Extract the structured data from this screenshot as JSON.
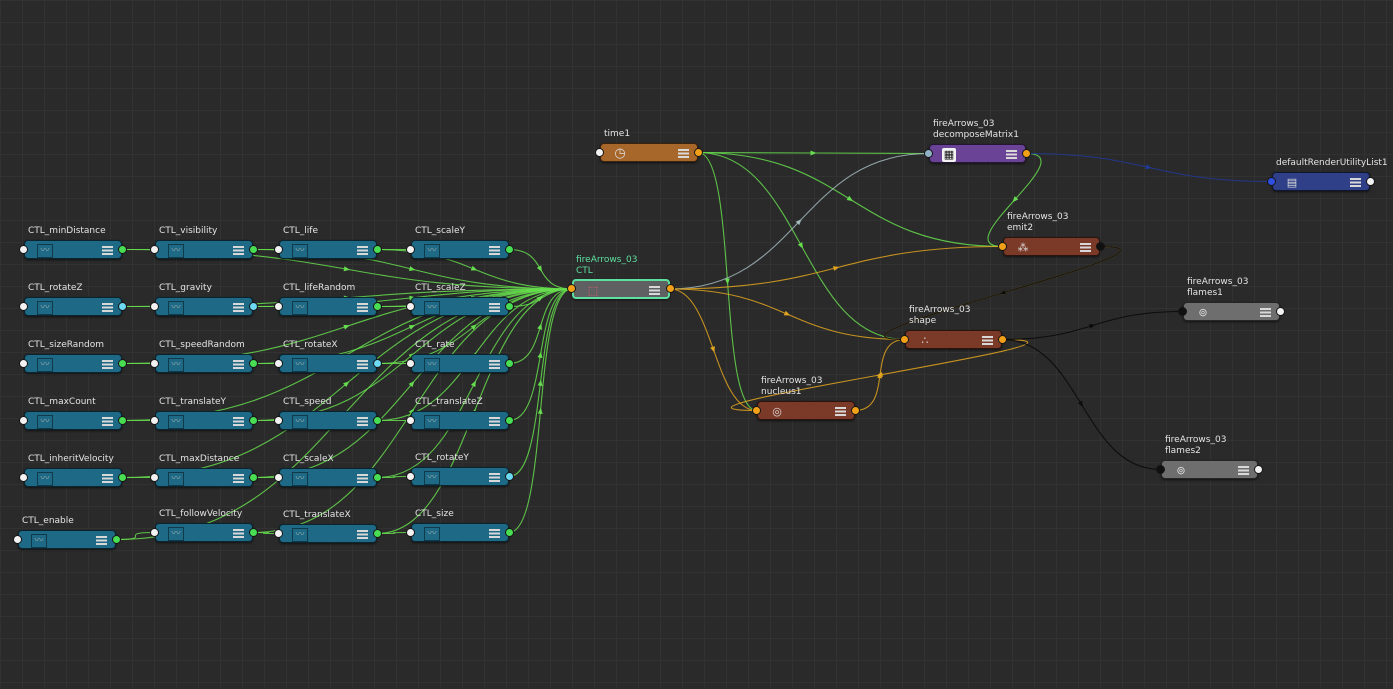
{
  "colors": {
    "ctl_node": "#1e6a86",
    "hub_node": "#5f6061",
    "time_node": "#a8672a",
    "decompose_node": "#6a4396",
    "render_node": "#2f3f88",
    "particle_node": "#7b3a28",
    "shape_node": "#6e6e6e",
    "port_green": "#49dd53",
    "port_white": "#f2f2f2",
    "port_cyan": "#6ed9f2",
    "port_orange": "#f2a018",
    "port_black": "#101010",
    "port_blue": "#2f4fe0",
    "port_slate": "#8fb3c5",
    "wire_green": "#66dd4e",
    "wire_orange": "#e0a420",
    "wire_dark": "#0c0c0c",
    "wire_navy": "#213a9a",
    "wire_grey": "#a2b8bc",
    "selection": "#5de0a0"
  },
  "nodes": [
    {
      "id": "ctl_minDistance",
      "label": "CTL_minDistance",
      "icon": "curve-icon",
      "color": "ctl_node",
      "in_port": "white",
      "out_port": "green"
    },
    {
      "id": "ctl_visibility",
      "label": "CTL_visibility",
      "icon": "curve-icon",
      "color": "ctl_node",
      "in_port": "white",
      "out_port": "green"
    },
    {
      "id": "ctl_life",
      "label": "CTL_life",
      "icon": "curve-icon",
      "color": "ctl_node",
      "in_port": "white",
      "out_port": "green"
    },
    {
      "id": "ctl_scaleY",
      "label": "CTL_scaleY",
      "icon": "curve-icon",
      "color": "ctl_node",
      "in_port": "white",
      "out_port": "green"
    },
    {
      "id": "ctl_rotateZ",
      "label": "CTL_rotateZ",
      "icon": "curve-icon",
      "color": "ctl_node",
      "in_port": "white",
      "out_port": "cyan"
    },
    {
      "id": "ctl_gravity",
      "label": "CTL_gravity",
      "icon": "curve-icon",
      "color": "ctl_node",
      "in_port": "white",
      "out_port": "cyan"
    },
    {
      "id": "ctl_lifeRandom",
      "label": "CTL_lifeRandom",
      "icon": "curve-icon",
      "color": "ctl_node",
      "in_port": "white",
      "out_port": "green"
    },
    {
      "id": "ctl_scaleZ",
      "label": "CTL_scaleZ",
      "icon": "curve-icon",
      "color": "ctl_node",
      "in_port": "white",
      "out_port": "green"
    },
    {
      "id": "ctl_sizeRandom",
      "label": "CTL_sizeRandom",
      "icon": "curve-icon",
      "color": "ctl_node",
      "in_port": "white",
      "out_port": "green"
    },
    {
      "id": "ctl_speedRandom",
      "label": "CTL_speedRandom",
      "icon": "curve-icon",
      "color": "ctl_node",
      "in_port": "white",
      "out_port": "green"
    },
    {
      "id": "ctl_rotateX",
      "label": "CTL_rotateX",
      "icon": "curve-icon",
      "color": "ctl_node",
      "in_port": "white",
      "out_port": "cyan"
    },
    {
      "id": "ctl_rate",
      "label": "CTL_rate",
      "icon": "curve-icon",
      "color": "ctl_node",
      "in_port": "white",
      "out_port": "green"
    },
    {
      "id": "ctl_maxCount",
      "label": "CTL_maxCount",
      "icon": "curve-icon",
      "color": "ctl_node",
      "in_port": "white",
      "out_port": "green"
    },
    {
      "id": "ctl_translateY",
      "label": "CTL_translateY",
      "icon": "curve-icon",
      "color": "ctl_node",
      "in_port": "white",
      "out_port": "green"
    },
    {
      "id": "ctl_speed",
      "label": "CTL_speed",
      "icon": "curve-icon",
      "color": "ctl_node",
      "in_port": "white",
      "out_port": "green"
    },
    {
      "id": "ctl_translateZ",
      "label": "CTL_translateZ",
      "icon": "curve-icon",
      "color": "ctl_node",
      "in_port": "white",
      "out_port": "green"
    },
    {
      "id": "ctl_inheritVelocity",
      "label": "CTL_inheritVelocity",
      "icon": "curve-icon",
      "color": "ctl_node",
      "in_port": "white",
      "out_port": "green"
    },
    {
      "id": "ctl_maxDistance",
      "label": "CTL_maxDistance",
      "icon": "curve-icon",
      "color": "ctl_node",
      "in_port": "white",
      "out_port": "green"
    },
    {
      "id": "ctl_scaleX",
      "label": "CTL_scaleX",
      "icon": "curve-icon",
      "color": "ctl_node",
      "in_port": "white",
      "out_port": "green"
    },
    {
      "id": "ctl_rotateY",
      "label": "CTL_rotateY",
      "icon": "curve-icon",
      "color": "ctl_node",
      "in_port": "white",
      "out_port": "cyan"
    },
    {
      "id": "ctl_enable",
      "label": "CTL_enable",
      "icon": "curve-icon",
      "color": "ctl_node",
      "in_port": "white",
      "out_port": "green"
    },
    {
      "id": "ctl_followVelocity",
      "label": "CTL_followVelocity",
      "icon": "curve-icon",
      "color": "ctl_node",
      "in_port": "white",
      "out_port": "green"
    },
    {
      "id": "ctl_translateX",
      "label": "CTL_translateX",
      "icon": "curve-icon",
      "color": "ctl_node",
      "in_port": "white",
      "out_port": "green"
    },
    {
      "id": "ctl_size",
      "label": "CTL_size",
      "icon": "curve-icon",
      "color": "ctl_node",
      "in_port": "white",
      "out_port": "green"
    },
    {
      "id": "ctl_hub",
      "label": "fireArrows_03\nCTL",
      "icon": "transform-icon",
      "color": "hub_node",
      "in_port": "orange",
      "out_port": "orange",
      "selected": true
    },
    {
      "id": "time1",
      "label": "time1",
      "icon": "clock-icon",
      "color": "time_node",
      "in_port": "white",
      "out_port": "orange"
    },
    {
      "id": "decompose",
      "label": "fireArrows_03\ndecomposeMatrix1",
      "icon": "matrix-icon",
      "color": "decompose_node",
      "in_port": "slate",
      "out_port": "orange"
    },
    {
      "id": "render_list",
      "label": "defaultRenderUtilityList1",
      "icon": "utility-list-icon",
      "color": "render_node",
      "in_port": "blue",
      "out_port": "white"
    },
    {
      "id": "emit2",
      "label": "fireArrows_03\nemit2",
      "icon": "emitter-icon",
      "color": "particle_node",
      "in_port": "orange",
      "out_port": "black"
    },
    {
      "id": "shape",
      "label": "fireArrows_03\nshape",
      "icon": "particles-icon",
      "color": "particle_node",
      "in_port": "orange",
      "out_port": "orange"
    },
    {
      "id": "nucleus1",
      "label": "fireArrows_03\nnucleus1",
      "icon": "nucleus-icon",
      "color": "particle_node",
      "in_port": "orange",
      "out_port": "orange"
    },
    {
      "id": "flames1",
      "label": "fireArrows_03\nflames1",
      "icon": "material-icon",
      "color": "shape_node",
      "in_port": "black",
      "out_port": "white"
    },
    {
      "id": "flames2",
      "label": "fireArrows_03\nflames2",
      "icon": "material-icon",
      "color": "shape_node",
      "in_port": "black",
      "out_port": "white"
    }
  ],
  "connections": [
    {
      "from": "ctl_minDistance",
      "to": "ctl_visibility",
      "color": "wire_green"
    },
    {
      "from": "ctl_visibility",
      "to": "ctl_life",
      "color": "wire_green"
    },
    {
      "from": "ctl_life",
      "to": "ctl_scaleY",
      "color": "wire_green"
    },
    {
      "from": "ctl_rotateZ",
      "to": "ctl_gravity",
      "color": "wire_green"
    },
    {
      "from": "ctl_gravity",
      "to": "ctl_lifeRandom",
      "color": "wire_green"
    },
    {
      "from": "ctl_lifeRandom",
      "to": "ctl_scaleZ",
      "color": "wire_green"
    },
    {
      "from": "ctl_sizeRandom",
      "to": "ctl_speedRandom",
      "color": "wire_green"
    },
    {
      "from": "ctl_speedRandom",
      "to": "ctl_rotateX",
      "color": "wire_green"
    },
    {
      "from": "ctl_rotateX",
      "to": "ctl_rate",
      "color": "wire_green"
    },
    {
      "from": "ctl_maxCount",
      "to": "ctl_translateY",
      "color": "wire_green"
    },
    {
      "from": "ctl_translateY",
      "to": "ctl_speed",
      "color": "wire_green"
    },
    {
      "from": "ctl_speed",
      "to": "ctl_translateZ",
      "color": "wire_green"
    },
    {
      "from": "ctl_inheritVelocity",
      "to": "ctl_maxDistance",
      "color": "wire_green"
    },
    {
      "from": "ctl_maxDistance",
      "to": "ctl_scaleX",
      "color": "wire_green"
    },
    {
      "from": "ctl_scaleX",
      "to": "ctl_rotateY",
      "color": "wire_green"
    },
    {
      "from": "ctl_enable",
      "to": "ctl_followVelocity",
      "color": "wire_green"
    },
    {
      "from": "ctl_followVelocity",
      "to": "ctl_translateX",
      "color": "wire_green"
    },
    {
      "from": "ctl_translateX",
      "to": "ctl_size",
      "color": "wire_green"
    },
    {
      "from": "ctl_minDistance",
      "to": "ctl_hub",
      "color": "wire_green"
    },
    {
      "from": "ctl_visibility",
      "to": "ctl_hub",
      "color": "wire_green"
    },
    {
      "from": "ctl_life",
      "to": "ctl_hub",
      "color": "wire_green"
    },
    {
      "from": "ctl_scaleY",
      "to": "ctl_hub",
      "color": "wire_green"
    },
    {
      "from": "ctl_rotateZ",
      "to": "ctl_hub",
      "color": "wire_green"
    },
    {
      "from": "ctl_gravity",
      "to": "ctl_hub",
      "color": "wire_green"
    },
    {
      "from": "ctl_lifeRandom",
      "to": "ctl_hub",
      "color": "wire_green"
    },
    {
      "from": "ctl_scaleZ",
      "to": "ctl_hub",
      "color": "wire_green"
    },
    {
      "from": "ctl_sizeRandom",
      "to": "ctl_hub",
      "color": "wire_green"
    },
    {
      "from": "ctl_speedRandom",
      "to": "ctl_hub",
      "color": "wire_green"
    },
    {
      "from": "ctl_rotateX",
      "to": "ctl_hub",
      "color": "wire_green"
    },
    {
      "from": "ctl_rate",
      "to": "ctl_hub",
      "color": "wire_green"
    },
    {
      "from": "ctl_maxCount",
      "to": "ctl_hub",
      "color": "wire_green"
    },
    {
      "from": "ctl_translateY",
      "to": "ctl_hub",
      "color": "wire_green"
    },
    {
      "from": "ctl_speed",
      "to": "ctl_hub",
      "color": "wire_green"
    },
    {
      "from": "ctl_translateZ",
      "to": "ctl_hub",
      "color": "wire_green"
    },
    {
      "from": "ctl_inheritVelocity",
      "to": "ctl_hub",
      "color": "wire_green"
    },
    {
      "from": "ctl_maxDistance",
      "to": "ctl_hub",
      "color": "wire_green"
    },
    {
      "from": "ctl_scaleX",
      "to": "ctl_hub",
      "color": "wire_green"
    },
    {
      "from": "ctl_rotateY",
      "to": "ctl_hub",
      "color": "wire_green"
    },
    {
      "from": "ctl_enable",
      "to": "ctl_hub",
      "color": "wire_green"
    },
    {
      "from": "ctl_followVelocity",
      "to": "ctl_hub",
      "color": "wire_green"
    },
    {
      "from": "ctl_translateX",
      "to": "ctl_hub",
      "color": "wire_green"
    },
    {
      "from": "ctl_size",
      "to": "ctl_hub",
      "color": "wire_green"
    },
    {
      "from": "time1",
      "to": "emit2",
      "color": "wire_green"
    },
    {
      "from": "time1",
      "to": "shape",
      "color": "wire_green"
    },
    {
      "from": "time1",
      "to": "nucleus1",
      "color": "wire_green"
    },
    {
      "from": "time1",
      "to": "decompose",
      "color": "wire_green"
    },
    {
      "from": "decompose",
      "to": "emit2",
      "color": "wire_green"
    },
    {
      "from": "ctl_hub",
      "to": "decompose",
      "color": "wire_grey"
    },
    {
      "from": "ctl_hub",
      "to": "emit2",
      "color": "wire_orange"
    },
    {
      "from": "ctl_hub",
      "to": "shape",
      "color": "wire_orange"
    },
    {
      "from": "ctl_hub",
      "to": "nucleus1",
      "color": "wire_orange"
    },
    {
      "from": "emit2",
      "to": "shape",
      "color": "wire_orange"
    },
    {
      "from": "shape",
      "to": "nucleus1",
      "color": "wire_orange"
    },
    {
      "from": "nucleus1",
      "to": "shape",
      "color": "wire_orange"
    },
    {
      "from": "emit2",
      "to": "shape",
      "color": "wire_dark"
    },
    {
      "from": "shape",
      "to": "flames1",
      "color": "wire_dark"
    },
    {
      "from": "shape",
      "to": "flames2",
      "color": "wire_dark"
    },
    {
      "from": "decompose",
      "to": "render_list",
      "color": "wire_navy"
    }
  ]
}
